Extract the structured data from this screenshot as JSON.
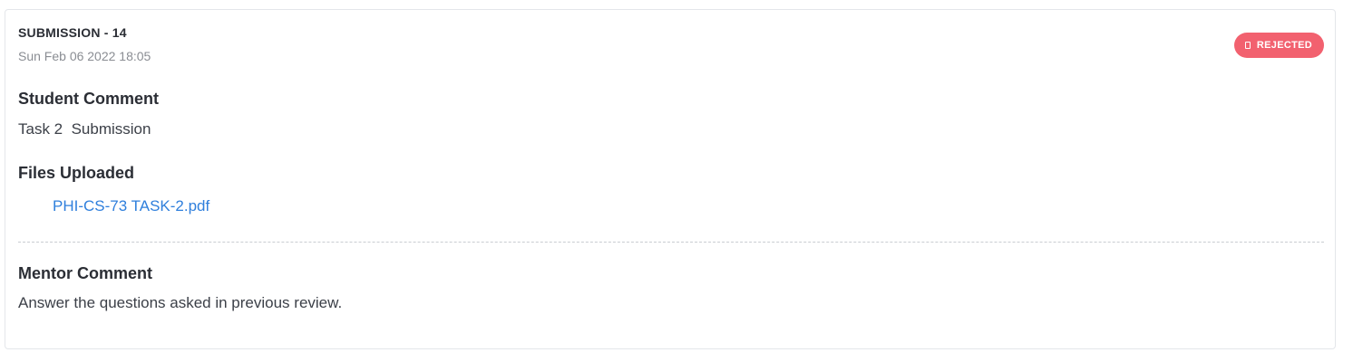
{
  "submission": {
    "title": "SUBMISSION - 14",
    "date": "Sun Feb 06 2022 18:05",
    "status": {
      "label": "REJECTED",
      "icon": "document-icon",
      "color": "#f2616f"
    }
  },
  "student_comment": {
    "heading": "Student Comment",
    "text": "Task 2  Submission"
  },
  "files": {
    "heading": "Files Uploaded",
    "items": [
      {
        "name": "PHI-CS-73 TASK-2.pdf"
      }
    ]
  },
  "mentor_comment": {
    "heading": "Mentor Comment",
    "text": "Answer the questions asked in previous review."
  },
  "colors": {
    "link": "#2f7fdc",
    "border": "#e4e6ea"
  }
}
